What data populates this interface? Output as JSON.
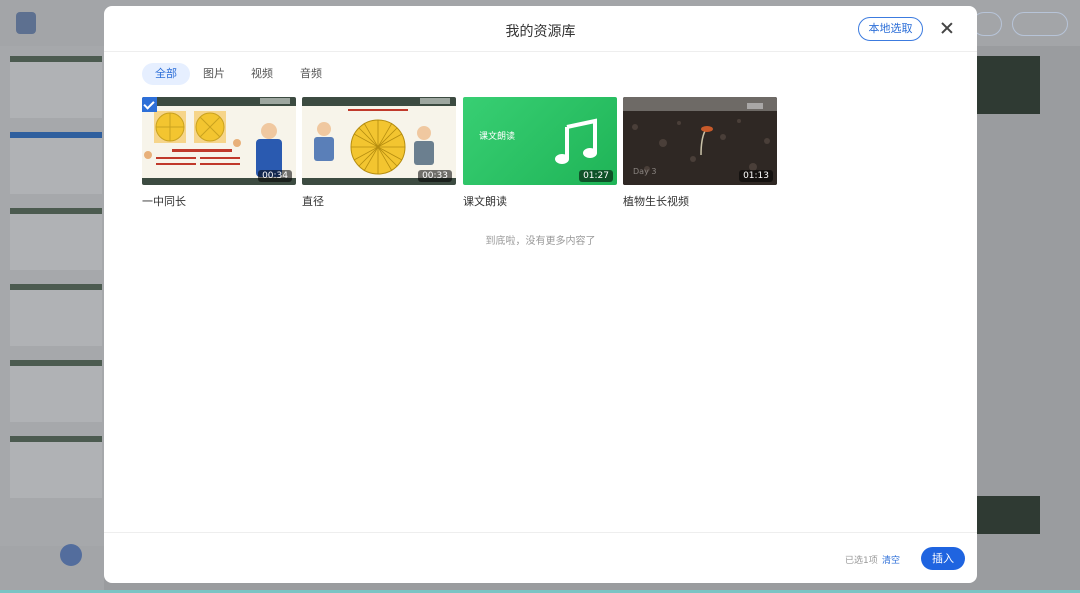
{
  "modal": {
    "title": "我的资源库",
    "local_pick_label": "本地选取",
    "tabs": [
      {
        "label": "全部",
        "active": true
      },
      {
        "label": "图片",
        "active": false
      },
      {
        "label": "视频",
        "active": false
      },
      {
        "label": "音频",
        "active": false
      }
    ],
    "resources": [
      {
        "label": "一中同长",
        "duration": "00:34",
        "selected": true,
        "thumb_icon": "lesson-video-thumbnail"
      },
      {
        "label": "直径",
        "duration": "00:33",
        "selected": false,
        "thumb_icon": "lesson-video-thumbnail"
      },
      {
        "label": "课文朗读",
        "duration": "01:27",
        "selected": false,
        "thumb_icon": "music-note-icon",
        "thumb_title": "课文朗读"
      },
      {
        "label": "植物生长视频",
        "duration": "01:13",
        "selected": false,
        "thumb_icon": "plant-seedling-thumbnail",
        "thumb_caption": "Day 3"
      }
    ],
    "end_text": "到底啦，没有更多内容了",
    "footer": {
      "selected_text": "已选1项",
      "clear_label": "清空",
      "insert_label": "插入"
    }
  },
  "colors": {
    "accent": "#1f64e0",
    "audio_green": "#2fc66a",
    "lesson_dark": "#3c4b41"
  }
}
